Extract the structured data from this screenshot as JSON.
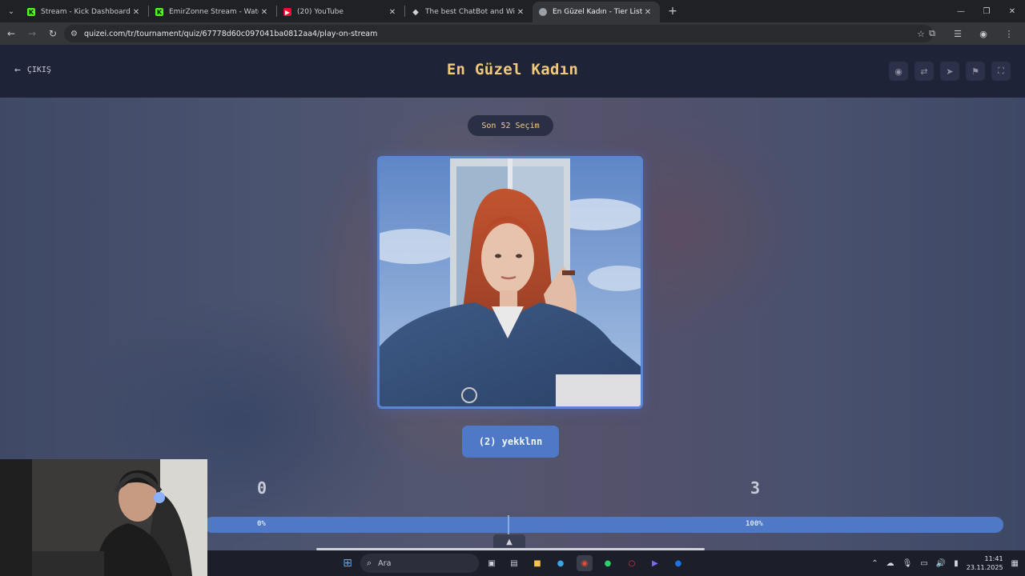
{
  "browser": {
    "tabs": [
      {
        "title": "Stream - Kick Dashboard",
        "favicon": "kick-icon",
        "color": "#53fc18",
        "active": false
      },
      {
        "title": "EmirZonne Stream - Watch Live",
        "favicon": "kick-icon",
        "color": "#53fc18",
        "active": false
      },
      {
        "title": "(20) YouTube",
        "favicon": "youtube-icon",
        "color": "#ff0033",
        "active": false
      },
      {
        "title": "The best ChatBot and Widgets",
        "favicon": "diamond-icon",
        "color": "#d0d0d0",
        "active": false
      },
      {
        "title": "En Güzel Kadın - Tier List, Kör S",
        "favicon": "globe-icon",
        "color": "#9aa0a6",
        "active": true
      }
    ],
    "url": "quizei.com/tr/tournament/quiz/67778d60c097041ba0812aa4/play-on-stream"
  },
  "header": {
    "exit_label": "ÇIKIŞ",
    "title": "En Güzel Kadın"
  },
  "quiz": {
    "round_label": "Son 52 Seçim",
    "choose_button": "(2) yekklnn",
    "score_left": "0",
    "score_right": "3",
    "progress_left_label": "0%",
    "progress_right_label": "100%",
    "progress_split_fraction": 0.38
  },
  "taskbar": {
    "search_placeholder": "Ara",
    "time": "11:41",
    "date": "23.11.2025"
  },
  "colors": {
    "accent": "#4f79c7",
    "title": "#f0c97a",
    "header_bg": "#1f2338"
  }
}
